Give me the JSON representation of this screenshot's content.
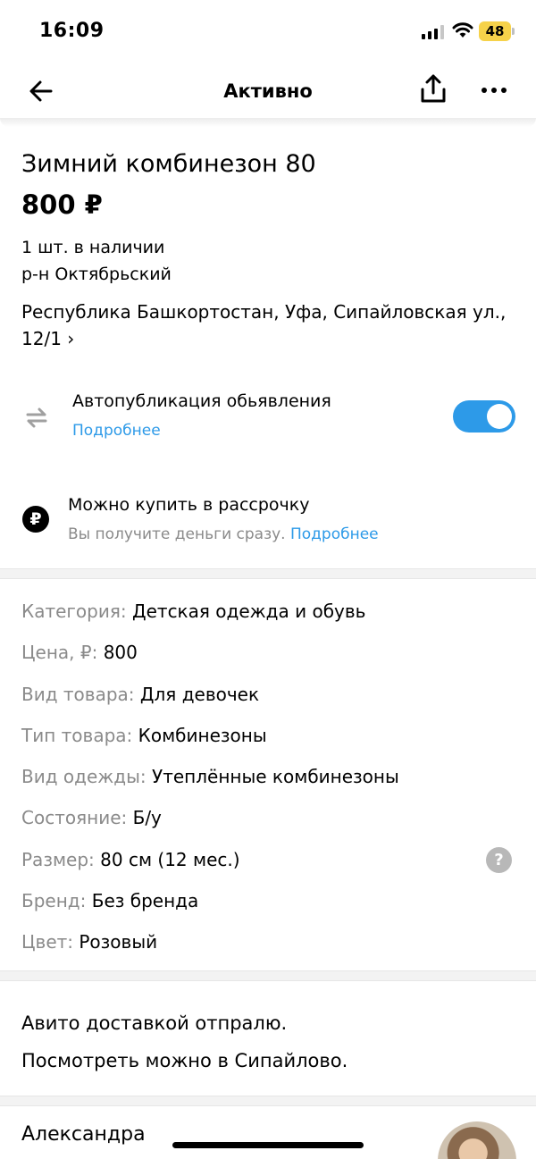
{
  "status_bar": {
    "time": "16:09",
    "battery": "48"
  },
  "nav": {
    "title": "Активно"
  },
  "listing": {
    "title": "Зимний комбинезон 80",
    "price": "800 ₽",
    "stock": "1 шт. в наличии",
    "district": "р-н Октябрьский",
    "address": "Республика Башкортостан, Уфа, Сипайловская ул., 12/1 ›"
  },
  "autopublish": {
    "title": "Автопубликация обьявления",
    "link": "Подробнее",
    "enabled": true
  },
  "installment": {
    "icon_glyph": "₽",
    "title": "Можно купить в рассрочку",
    "subtitle": "Вы получите деньги сразу. ",
    "link": "Подробнее"
  },
  "params": [
    {
      "key": "Категория:",
      "value": "Детская одежда и обувь"
    },
    {
      "key": "Цена, ₽:",
      "value": "800"
    },
    {
      "key": "Вид товара:",
      "value": "Для девочек"
    },
    {
      "key": "Тип товара:",
      "value": "Комбинезоны"
    },
    {
      "key": "Вид одежды:",
      "value": "Утеплённые комбинезоны"
    },
    {
      "key": "Состояние:",
      "value": "Б/у"
    },
    {
      "key": "Размер:",
      "value": "80 см (12 мес.)",
      "help_icon": "?"
    },
    {
      "key": "Бренд:",
      "value": "Без бренда"
    },
    {
      "key": "Цвет:",
      "value": "Розовый"
    }
  ],
  "description": {
    "line1": "Авито доставкой отпралю.",
    "line2": "Посмотреть можно в Сипайлово."
  },
  "seller": {
    "name": "Александра"
  },
  "colors": {
    "accent": "#2d9ae8",
    "muted": "#8a8a8a",
    "battery": "#f6d24a"
  },
  "icons": {
    "back": "arrow-left-icon",
    "share": "share-icon",
    "more": "more-dots-icon",
    "autopublish": "repeat-icon",
    "installment": "ruble-icon",
    "help": "question-icon"
  }
}
